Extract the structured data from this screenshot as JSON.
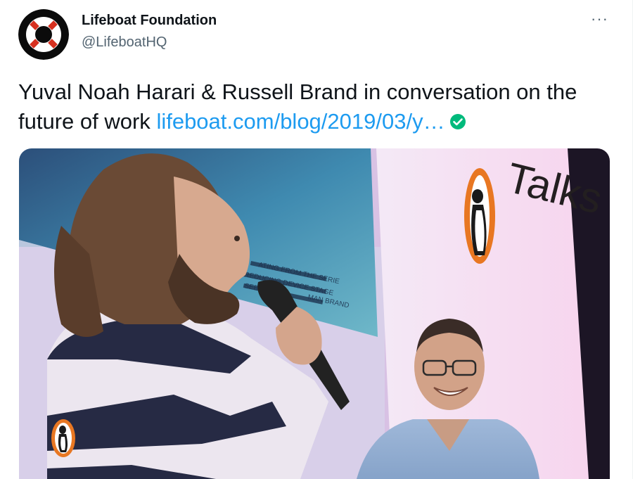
{
  "author": {
    "name": "Lifeboat Foundation",
    "handle": "@LifeboatHQ"
  },
  "tweet": {
    "text": "Yuval Noah Harari & Russell Brand in conversation on the future of work",
    "link_text": "lifeboat.com/blog/2019/03/y…",
    "link_badge_icon": "check-circle-icon"
  },
  "more_label": "···",
  "media": {
    "screen_text": [
      "ATING FROM THE SERIE",
      "REDUCING DEVICE STAGE",
      "SEE",
      "MAN BRAND"
    ],
    "sign_text": "Talks",
    "logo_icon": "penguin-logo-icon"
  },
  "colors": {
    "link": "#1d9bf0",
    "handle": "#536471",
    "text": "#0f1419",
    "badge": "#00ba7c"
  }
}
